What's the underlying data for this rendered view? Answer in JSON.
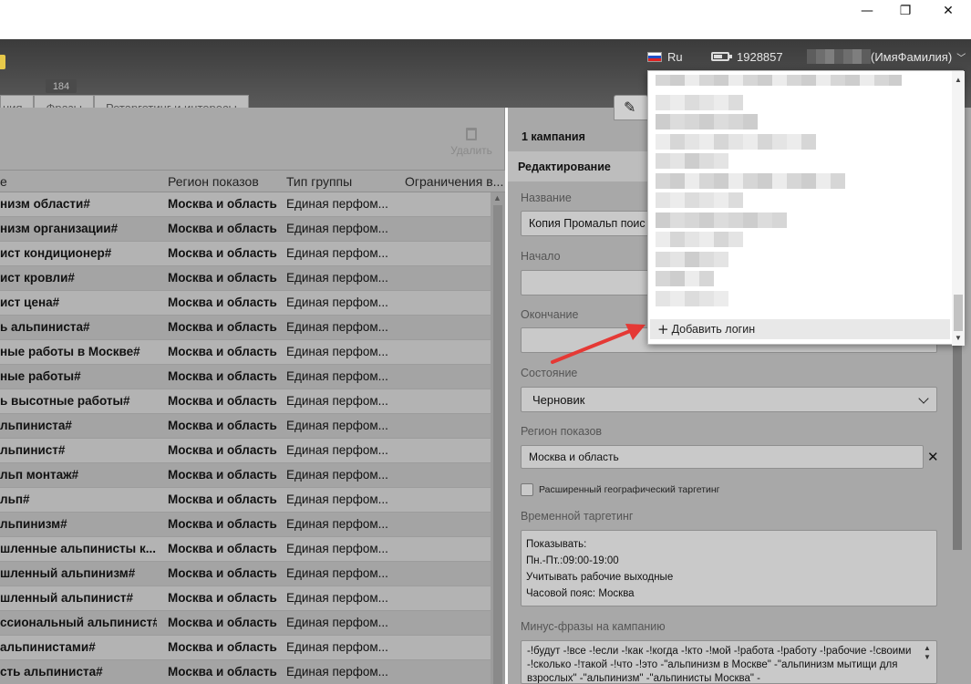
{
  "window_controls": {
    "minimize": "—",
    "maximize": "❐",
    "close": "✕"
  },
  "topbar": {
    "language": "Ru",
    "balance": "1928857",
    "user": "(ИмяФамилия)"
  },
  "tabs": {
    "count_badge": "184",
    "items": [
      "ния",
      "Фразы",
      "Ретаргетинг и интересы"
    ]
  },
  "left_toolbar": {
    "delete_label": "Удалить"
  },
  "table": {
    "columns": [
      "е",
      "Регион показов",
      "Тип группы",
      "Ограничения в..."
    ],
    "rows": [
      [
        "низм области#",
        "Москва и область",
        "Единая перфом..."
      ],
      [
        "низм организации#",
        "Москва и область",
        "Единая перфом..."
      ],
      [
        "ист кондиционер#",
        "Москва и область",
        "Единая перфом..."
      ],
      [
        "ист кровли#",
        "Москва и область",
        "Единая перфом..."
      ],
      [
        "ист цена#",
        "Москва и область",
        "Единая перфом..."
      ],
      [
        "ь альпиниста#",
        "Москва и область",
        "Единая перфом..."
      ],
      [
        "ные работы в Москве#",
        "Москва и область",
        "Единая перфом..."
      ],
      [
        "ные работы#",
        "Москва и область",
        "Единая перфом..."
      ],
      [
        "ь высотные работы#",
        "Москва и область",
        "Единая перфом..."
      ],
      [
        "льпиниста#",
        "Москва и область",
        "Единая перфом..."
      ],
      [
        "льпинист#",
        "Москва и область",
        "Единая перфом..."
      ],
      [
        "льп монтаж#",
        "Москва и область",
        "Единая перфом..."
      ],
      [
        "льп#",
        "Москва и область",
        "Единая перфом..."
      ],
      [
        "льпинизм#",
        "Москва и область",
        "Единая перфом..."
      ],
      [
        "шленные альпинисты к...",
        "Москва и область",
        "Единая перфом..."
      ],
      [
        "шленный альпинизм#",
        "Москва и область",
        "Единая перфом..."
      ],
      [
        "шленный альпинист#",
        "Москва и область",
        "Единая перфом..."
      ],
      [
        "ссиональный альпинист#",
        "Москва и область",
        "Единая перфом..."
      ],
      [
        "альпинистами#",
        "Москва и область",
        "Единая перфом..."
      ],
      [
        "сть альпиниста#",
        "Москва и область",
        "Единая перфом..."
      ]
    ]
  },
  "right_panel": {
    "campaign_count": "1 кампания",
    "section_title": "Редактирование",
    "name_label": "Название",
    "name_value": "Копия Промальп поис",
    "start_label": "Начало",
    "start_value": "",
    "end_label": "Окончание",
    "end_value": "",
    "state_label": "Состояние",
    "state_value": "Черновик",
    "region_label": "Регион показов",
    "region_value": "Москва и область",
    "region_clear": "✕",
    "ext_geo_label": "Расширенный географический таргетинг",
    "ext_geo_checked": false,
    "time_label": "Временной таргетинг",
    "time_lines": [
      "Показывать:",
      "Пн.-Пт.:09:00-19:00",
      "Учитывать рабочие выходные",
      "Часовой пояс: Москва"
    ],
    "minus_label": "Минус-фразы на кампанию",
    "minus_text": "-!будут -!все -!если -!как -!когда -!кто -!мой -!работа -!работу -!рабочие -!своими -!сколько -!такой -!что -!это -\"альпинизм в Москве\" -\"альпинизм мытищи для взрослых\" -\"альпинизм\" -\"альпинисты Москва\" -"
  },
  "account_dropdown": {
    "add_login_label": "Добавить логин",
    "add_login_icon": "+"
  },
  "colors": {
    "annotation_arrow": "#e53935",
    "app_dark": "#3b3b3b",
    "dimmed_panel": "#a8a8a8"
  }
}
